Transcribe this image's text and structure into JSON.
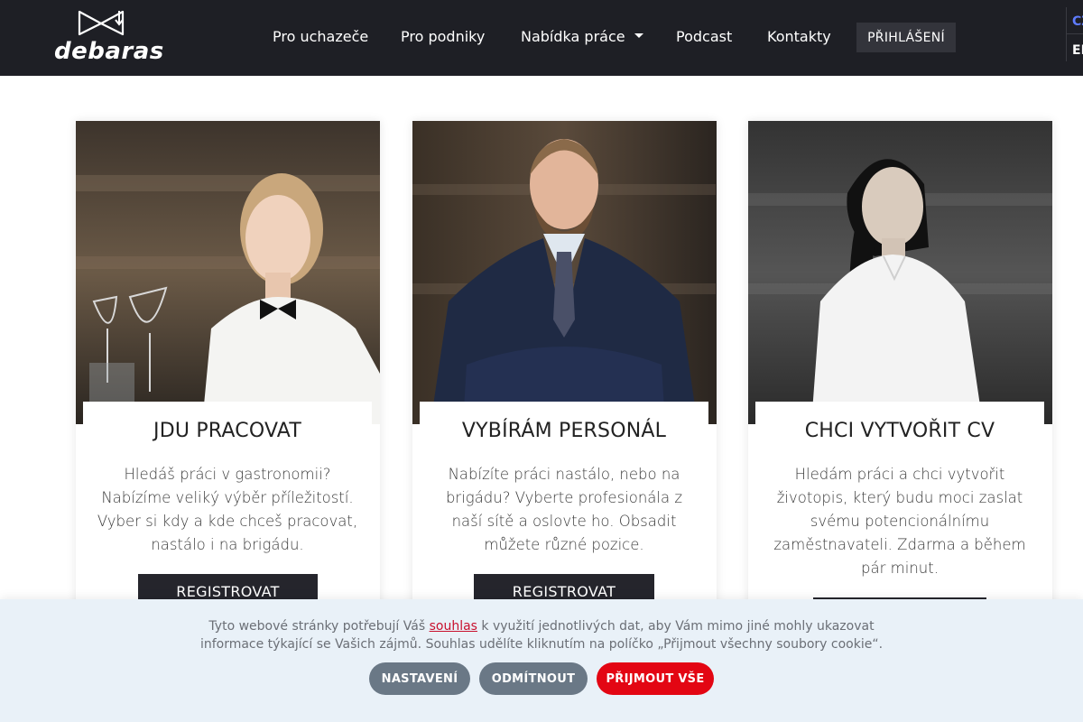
{
  "brand": {
    "name": "debaras"
  },
  "nav": {
    "items": [
      "Pro uchazeče",
      "Pro podniky",
      "Nabídka práce",
      "Podcast",
      "Kontakty"
    ],
    "login": "PŘIHLÁŠENÍ",
    "languages": [
      "CZ",
      "EN"
    ],
    "active_language_color": "#5f7cff"
  },
  "cards": [
    {
      "title": "JDU PRACOVAT",
      "text": "Hledáš práci v gastronomii? Nabízíme veliký výběr příležitostí. Vyber si kdy a kde chceš pracovat, nastálo i na brigádu.",
      "button": "REGISTROVAT",
      "photo": "waitress-with-wine-glasses"
    },
    {
      "title": "VYBÍRÁM PERSONÁL",
      "text": "Nabízíte práci nastálo, nebo na brigádu? Vyberte profesionála z naší sítě a oslovte ho. Obsadit můžete různé pozice.",
      "button": "REGISTROVAT",
      "photo": "businessman-in-suit"
    },
    {
      "title": "CHCI VYTVOŘIT CV",
      "text": "Hledám práci a chci vytvořit životopis, který budu moci zaslat svému potencionálnímu zaměstnavateli. Zdarma a během pár minut.",
      "button": "",
      "photo": "young-woman-white-shirt"
    }
  ],
  "cookie": {
    "text_before": "Tyto webové stránky potřebují Váš ",
    "link": "souhlas",
    "text_after": " k využití jednotlivých dat, aby Vám mimo jiné mohly ukazovat informace týkající se Vašich zájmů. Souhlas udělíte kliknutím na políčko „Přijmout všechny soubory cookie“.",
    "buttons": {
      "settings": "NASTAVENÍ",
      "reject": "ODMÍTNOUT",
      "accept": "PŘIJMOUT VŠE"
    }
  },
  "colors": {
    "header_bg": "#1e1f25",
    "accent_red": "#e30613",
    "cookie_bg": "#e9f1f8",
    "button_dark": "#25252c"
  }
}
